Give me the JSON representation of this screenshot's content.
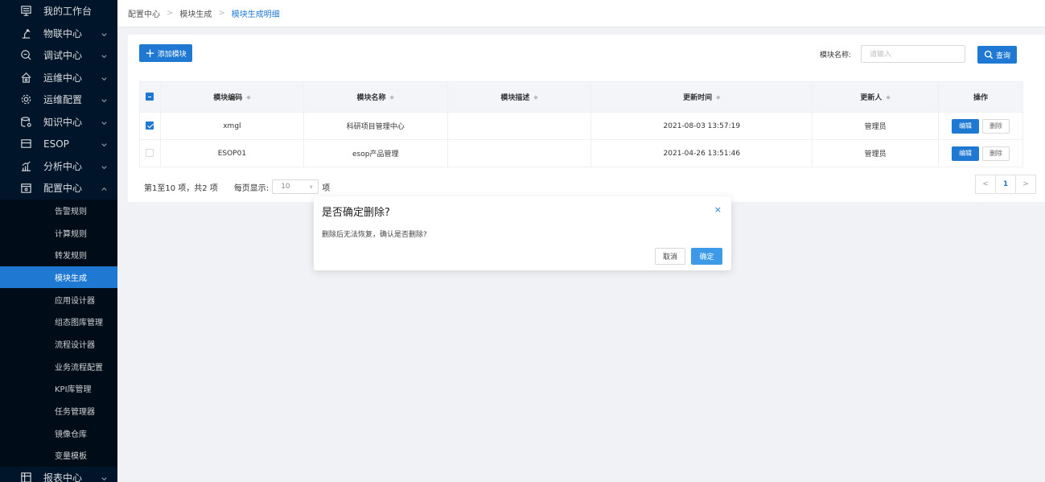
{
  "sidebar": {
    "items": [
      {
        "label": "我的工作台",
        "icon": "desktop-icon",
        "has_chevron": false
      },
      {
        "label": "物联中心",
        "icon": "robot-arm-icon",
        "has_chevron": true,
        "chevron": "down"
      },
      {
        "label": "调试中心",
        "icon": "debug-icon",
        "has_chevron": true,
        "chevron": "down"
      },
      {
        "label": "运维中心",
        "icon": "home-icon",
        "has_chevron": true,
        "chevron": "down"
      },
      {
        "label": "运维配置",
        "icon": "gear-icon",
        "has_chevron": true,
        "chevron": "down"
      },
      {
        "label": "知识中心",
        "icon": "database-icon",
        "has_chevron": true,
        "chevron": "down"
      },
      {
        "label": "ESOP",
        "icon": "esop-icon",
        "has_chevron": true,
        "chevron": "down"
      },
      {
        "label": "分析中心",
        "icon": "chart-icon",
        "has_chevron": true,
        "chevron": "down"
      },
      {
        "label": "配置中心",
        "icon": "config-icon",
        "has_chevron": true,
        "chevron": "up"
      }
    ],
    "sub_items": [
      {
        "label": "告警规则",
        "active": false
      },
      {
        "label": "计算规则",
        "active": false
      },
      {
        "label": "转发规则",
        "active": false
      },
      {
        "label": "模块生成",
        "active": true
      },
      {
        "label": "应用设计器",
        "active": false
      },
      {
        "label": "组态图库管理",
        "active": false
      },
      {
        "label": "流程设计器",
        "active": false
      },
      {
        "label": "业务流程配置",
        "active": false
      },
      {
        "label": "KPI库管理",
        "active": false
      },
      {
        "label": "任务管理器",
        "active": false
      },
      {
        "label": "镜像仓库",
        "active": false
      },
      {
        "label": "变量模板",
        "active": false
      }
    ],
    "bottom_item": {
      "label": "报表中心",
      "icon": "report-icon",
      "chevron": "down"
    }
  },
  "breadcrumb": [
    "配置中心",
    "模块生成",
    "模块生成明细"
  ],
  "toolbar": {
    "add_label": "添加模块",
    "filter_label": "模块名称:",
    "filter_placeholder": "请输入",
    "query_label": "查询"
  },
  "table": {
    "columns": [
      "模块编码",
      "模块名称",
      "模块描述",
      "更新时间",
      "更新人",
      "操作"
    ],
    "rows": [
      {
        "checked": true,
        "code": "xmgl",
        "name": "科研项目管理中心",
        "desc": "",
        "time": "2021-08-03 13:57:19",
        "user": "管理员"
      },
      {
        "checked": false,
        "code": "ESOP01",
        "name": "esop产品管理",
        "desc": "",
        "time": "2021-04-26 13:51:46",
        "user": "管理员"
      }
    ],
    "edit_label": "编辑",
    "delete_label": "删除"
  },
  "pagination": {
    "summary": "第1至10 项，共2 项",
    "per_page_label": "每页显示:",
    "per_page_value": "10",
    "unit": "项",
    "prev": "<",
    "current": "1",
    "next": ">"
  },
  "modal": {
    "title": "是否确定删除?",
    "close": "×",
    "message": "删除后无法恢复，确认是否删除?",
    "cancel_label": "取消",
    "ok_label": "确定"
  },
  "colors": {
    "sidebar_bg": "#001529",
    "accent": "#1f78d1",
    "modal_ok": "#3d9ae8"
  }
}
